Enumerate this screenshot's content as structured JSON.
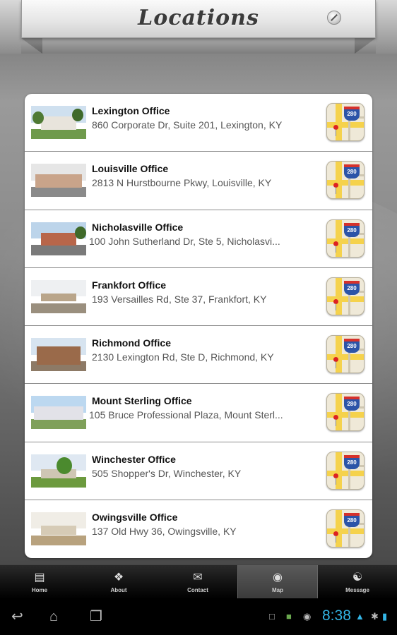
{
  "header": {
    "title": "Locations"
  },
  "locations": [
    {
      "name": "Lexington Office",
      "address": "860 Corporate Dr, Suite 201, Lexington, KY"
    },
    {
      "name": "Louisville Office",
      "address": "2813 N Hurstbourne Pkwy, Louisville, KY"
    },
    {
      "name": "Nicholasville Office",
      "address": "100 John Sutherland Dr, Ste 5, Nicholasvi..."
    },
    {
      "name": "Frankfort Office",
      "address": "193 Versailles Rd, Ste 37, Frankfort, KY"
    },
    {
      "name": "Richmond Office",
      "address": "2130 Lexington Rd, Ste D, Richmond, KY"
    },
    {
      "name": "Mount Sterling Office",
      "address": "105 Bruce Professional Plaza, Mount Sterl..."
    },
    {
      "name": "Winchester Office",
      "address": "505 Shopper's Dr, Winchester, KY"
    },
    {
      "name": "Owingsville Office",
      "address": "137 Old Hwy 36, Owingsville, KY"
    }
  ],
  "map_icon": {
    "shield_text": "280"
  },
  "tabs": [
    {
      "label": "Home",
      "icon": "home-icon"
    },
    {
      "label": "About",
      "icon": "tag-icon"
    },
    {
      "label": "Contact",
      "icon": "envelope-icon"
    },
    {
      "label": "Map",
      "icon": "globe-icon",
      "selected": true
    },
    {
      "label": "Message",
      "icon": "chat-icon"
    }
  ],
  "status_bar": {
    "time": "8:38"
  },
  "colors": {
    "accent_clock": "#33b5e5",
    "tab_selected": "#4a4a4a"
  }
}
